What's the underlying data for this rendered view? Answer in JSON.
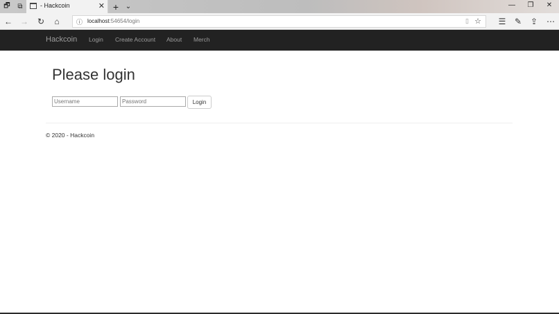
{
  "browser": {
    "tab_title": "- Hackcoin",
    "url_host": "localhost",
    "url_path": ":54654/login",
    "icons": {
      "set_aside": "windows-icon",
      "tab_preview": "tab-preview-icon",
      "tab_favicon": "page-icon",
      "tab_close": "close-icon",
      "new_tab": "plus-icon",
      "tab_list": "chevron-down-icon",
      "minimize": "minimize-icon",
      "maximize": "restore-icon",
      "window_close": "close-icon",
      "back": "back-arrow-icon",
      "forward": "forward-arrow-icon",
      "refresh": "refresh-icon",
      "home": "home-icon",
      "site_info": "info-icon",
      "reading_view": "book-icon",
      "favorite": "star-icon",
      "favorites_hub": "favorites-list-icon",
      "notes": "pen-icon",
      "share": "share-icon",
      "more": "more-dots-icon"
    }
  },
  "navbar": {
    "brand": "Hackcoin",
    "links": [
      "Login",
      "Create Account",
      "About",
      "Merch"
    ]
  },
  "main": {
    "heading": "Please login",
    "username_placeholder": "Username",
    "password_placeholder": "Password",
    "login_button": "Login"
  },
  "footer": {
    "text": "© 2020 - Hackcoin"
  },
  "colors": {
    "navbar_bg": "#222222",
    "navbar_text": "#9d9d9d",
    "heading_text": "#333333"
  }
}
